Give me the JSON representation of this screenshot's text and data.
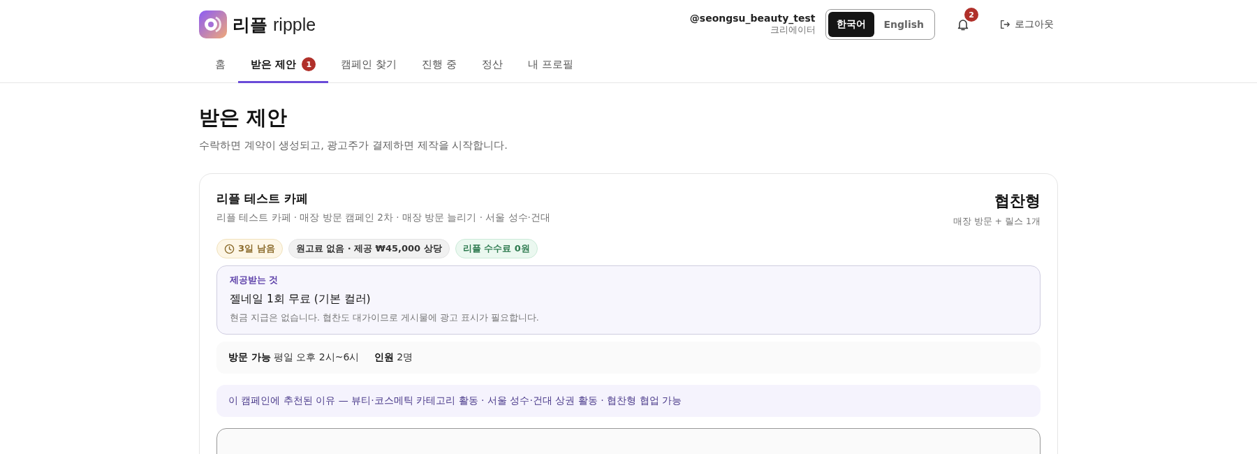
{
  "header": {
    "logo": {
      "korean": "리플",
      "latin": "ripple"
    },
    "user": {
      "handle": "@seongsu_beauty_test",
      "role": "크리에이터"
    },
    "languages": [
      {
        "label": "한국어",
        "selected": true
      },
      {
        "label": "English",
        "selected": false
      }
    ],
    "notifications": {
      "count": "2"
    },
    "logout": "로그아웃"
  },
  "tabs": [
    {
      "label": "홈",
      "selected": false
    },
    {
      "label": "받은 제안",
      "selected": true,
      "badge": "1"
    },
    {
      "label": "캠페인 찾기",
      "selected": false
    },
    {
      "label": "진행 중",
      "selected": false
    },
    {
      "label": "정산",
      "selected": false
    },
    {
      "label": "내 프로필",
      "selected": false
    }
  ],
  "page": {
    "title": "받은 제안",
    "subtitle": "수락하면 계약이 생성되고, 광고주가 결제하면 제작을 시작합니다."
  },
  "offer": {
    "brand": "리플 테스트 카페",
    "meta": "리플 테스트 카페 · 매장 방문 캠페인 2차 · 매장 방문 늘리기 · 서울 성수·건대",
    "type": "협찬형",
    "deliverables": "매장 방문 + 릴스 1개",
    "tags": [
      {
        "kind": "deadline",
        "label": "3일 남음"
      },
      {
        "kind": "neutral",
        "label": "원고료 없음 · 제공 ₩45,000 상당"
      },
      {
        "kind": "success",
        "label": "리플 수수료 0원"
      }
    ],
    "provided": {
      "heading": "제공받는 것",
      "item": "젤네일 1회 무료 (기본 컬러)",
      "note": "현금 지급은 없습니다. 협찬도 대가이므로 게시물에 광고 표시가 필요합니다."
    },
    "details": [
      {
        "label": "방문 가능",
        "value": "평일 오후 2시~6시"
      },
      {
        "label": "인원",
        "value": "2명"
      }
    ],
    "reason": "이 캠페인에 추천된 이유 — 뷰티·코스메틱 카테고리 활동 · 서울 성수·건대 상권 활동 · 협찬형 협업 가능"
  }
}
